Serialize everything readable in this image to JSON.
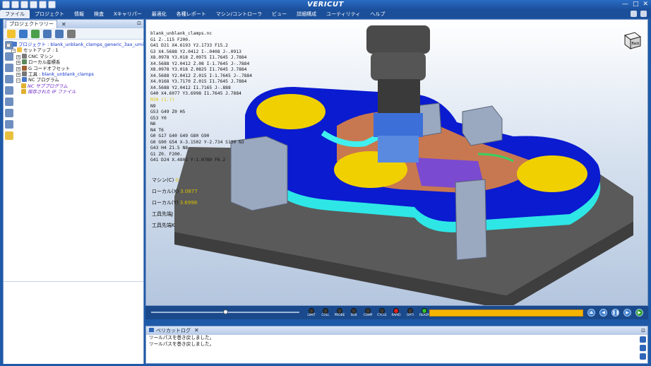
{
  "app": {
    "title": "VERICUT",
    "window_controls": [
      "—",
      "□",
      "✕"
    ]
  },
  "menu": {
    "items": [
      "ファイル",
      "プロジェクト",
      "情報",
      "検査",
      "Xキャリパー",
      "最適化",
      "各種レポート",
      "マシン/コントローラ",
      "ビュー",
      "詳細構成",
      "ユーティリティ",
      "ヘルプ"
    ],
    "active_index": 0
  },
  "project_tree": {
    "tab_label": "プロジェクトツリー",
    "close_glyph": "✕",
    "rows": [
      {
        "text": "プロジェクト : blank_unblank_clamps_generic_3ax_umill_fan30im",
        "style": "blue",
        "indent": 0,
        "exp": "⊟"
      },
      {
        "text": "セットアップ : 1",
        "style": "",
        "indent": 1,
        "exp": "⊟"
      },
      {
        "text": "CNC マシン",
        "style": "",
        "indent": 2,
        "exp": "⊞"
      },
      {
        "text": "ローカル座標系",
        "style": "",
        "indent": 2,
        "exp": "⊞"
      },
      {
        "text": "G コードオフセット",
        "style": "",
        "indent": 2,
        "exp": "⊞"
      },
      {
        "text": "工具 : ",
        "style": "",
        "indent": 2,
        "exp": "⊞",
        "suffix": "blank_unblank_clamps"
      },
      {
        "text": "NC プログラム",
        "style": "",
        "indent": 2,
        "exp": "⊟"
      },
      {
        "text": "NC サブプログラム",
        "style": "purple",
        "indent": 3,
        "exp": ""
      },
      {
        "text": "保存された IP ファイル",
        "style": "purple",
        "indent": 3,
        "exp": ""
      }
    ]
  },
  "viewport": {
    "nc_lines": [
      "blank_unblank_clamps.nc",
      "G1 Z-.115 F200.",
      "G41 D21 X4.6193 Y2.1733 F15.2",
      "G3 X4.5688 Y2.0412 I-.0408 J-.0913",
      "X8.0978 Y3.018 Z.0975 I1.7645 J.7884",
      "X4.5688 Y2.0412 Z.08 I-1.7645 J-.7884",
      "X8.0978 Y3.018 Z.0825 I1.7645 J.7884",
      "X4.5688 Y2.0412 Z.015 I-1.7645 J-.7884",
      "X4.0168 Y3.7170 Z.015 I1.7645 J.7884",
      "X4.5688 Y2.0412 I1.7165 J-.888",
      "G40 X4.6077 Y3.6998 I1.7645 J.7884",
      "M30 (1.?)",
      "N9",
      "G53 G49 Z0 H5",
      "G53 Y0",
      "N6",
      "N4 T6",
      "G0 G17 G40 G49 G80 G90",
      "G0 G90 G54 X-3.1502 Y-2.734 S130 N3",
      "G43 H4 Z1.5 N8",
      "G1 Z0. F200.",
      "G41 D24 X.4801 Y-1.0789 F6.2"
    ],
    "highlight_line_index": 11,
    "readouts": [
      {
        "label": "マシン(C)",
        "value": "0"
      },
      {
        "label": "ローカル(X)",
        "value": "3.0877"
      },
      {
        "label": "ローカル(Y)",
        "value": "3.6998"
      },
      {
        "label": "工具先端J",
        "value": ""
      },
      {
        "label": "工具先端K",
        "value": ""
      }
    ],
    "viewcube_label": "Back"
  },
  "playback": {
    "slider_position": 0.5,
    "leds": [
      {
        "label": "LIMIT",
        "color": "#3a3a3a"
      },
      {
        "label": "COLL",
        "color": "#3a3a3a"
      },
      {
        "label": "PROBE",
        "color": "#3a3a3a"
      },
      {
        "label": "SUB",
        "color": "#3a3a3a"
      },
      {
        "label": "COMP",
        "color": "#3a3a3a"
      },
      {
        "label": "CYCLE",
        "color": "#3a3a3a"
      },
      {
        "label": "RAPID",
        "color": "#e02020"
      },
      {
        "label": "OPTI",
        "color": "#3a3a3a"
      },
      {
        "label": "READY",
        "color": "#30c030"
      }
    ],
    "buttons": [
      "reset",
      "step-back",
      "pause",
      "step",
      "play"
    ]
  },
  "log": {
    "title": "ベリカットログ",
    "close_glyph": "✕",
    "lines": [
      "ツールパスを巻き戻しました。",
      "ツールパスを巻き戻しました。"
    ]
  },
  "colors": {
    "accent": "#1b4f9a",
    "progress": "#f5b400",
    "part_blue": "#0a1bd0",
    "part_cyan": "#2ee6e6",
    "pocket_yellow": "#f0d000"
  }
}
